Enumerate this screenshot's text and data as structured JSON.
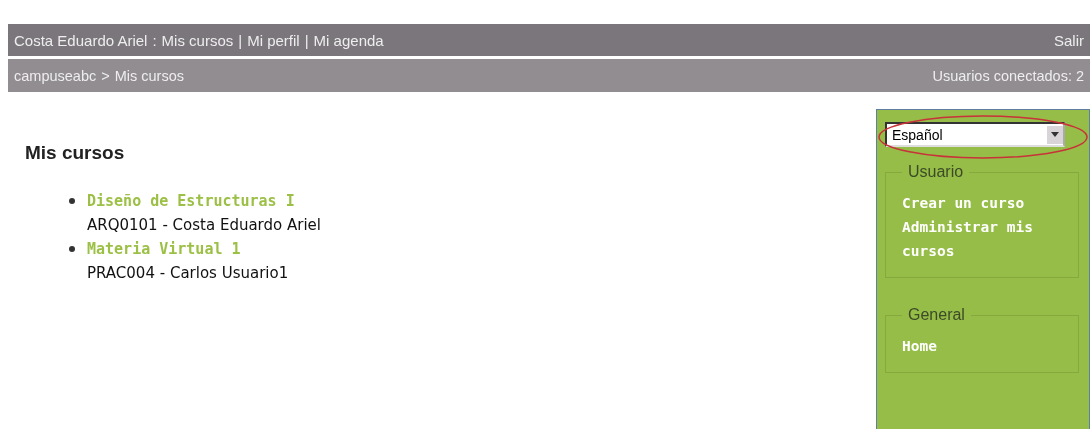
{
  "top_bar": {
    "user": "Costa Eduardo Ariel",
    "links": [
      {
        "separator": ":",
        "label": "Mis cursos"
      },
      {
        "separator": "|",
        "label": "Mi perfil"
      },
      {
        "separator": "|",
        "label": "Mi agenda"
      }
    ],
    "logout": "Salir"
  },
  "breadcrumb": {
    "home": "campuseabc",
    "separator": ">",
    "current": "Mis cursos",
    "online_users": "Usuarios conectados: 2"
  },
  "heading": "Mis cursos",
  "courses": [
    {
      "title": "Diseño de Estructuras I",
      "info": "ARQ0101 - Costa Eduardo Ariel"
    },
    {
      "title": "Materia Virtual 1",
      "info": "PRAC004 - Carlos Usuario1"
    }
  ],
  "sidebar": {
    "language": {
      "value": "Español",
      "highlighted": true
    },
    "sections": [
      {
        "title": "Usuario",
        "links": [
          "Crear un curso",
          "Administrar mis cursos"
        ]
      },
      {
        "title": "General",
        "links": [
          "Home"
        ]
      }
    ]
  }
}
